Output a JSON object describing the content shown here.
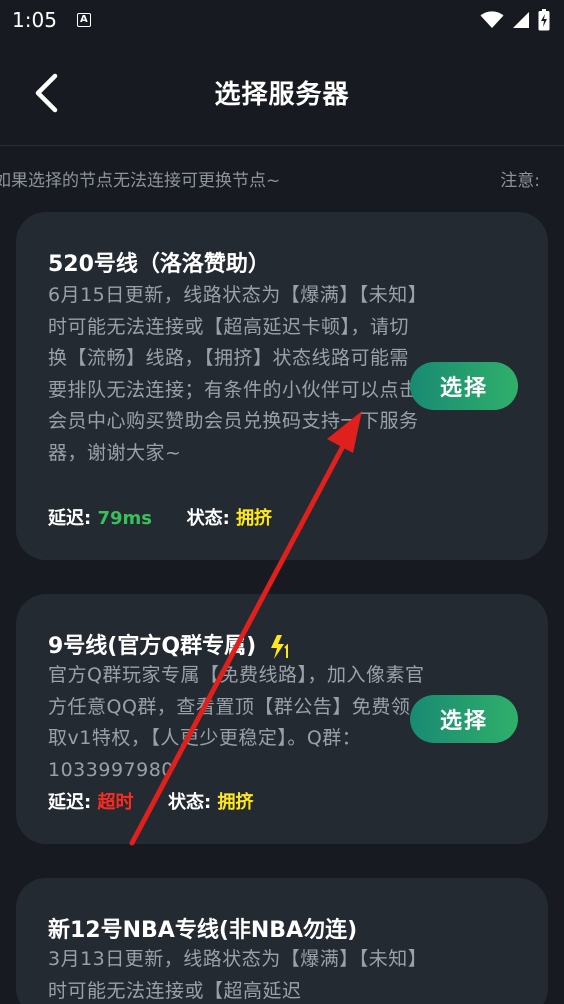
{
  "status_bar": {
    "time": "1:05",
    "a_badge": "A"
  },
  "header": {
    "title": "选择服务器"
  },
  "notice": {
    "text": "如果选择的节点无法连接可更换节点~",
    "label": "注意:"
  },
  "servers": [
    {
      "name": "520号线（洛洛赞助）",
      "description": "6月15日更新，线路状态为【爆满】【未知】时可能无法连接或【超高延迟卡顿】，请切换【流畅】线路，【拥挤】状态线路可能需要排队无法连接；有条件的小伙伴可以点击会员中心购买赞助会员兑换码支持一下服务器，谢谢大家~",
      "latency_label": "延迟:",
      "latency_value": "79ms",
      "status_label": "状态:",
      "status_value": "拥挤",
      "button_label": "选择"
    },
    {
      "name": "9号线(官方Q群专属)",
      "description": "官方Q群玩家专属【免费线路】，加入像素官方任意QQ群，查看置顶【群公告】免费领取v1特权，【人更少更稳定】。Q群：1033997980",
      "latency_label": "延迟:",
      "latency_value": "超时",
      "status_label": "状态:",
      "status_value": "拥挤",
      "button_label": "选择",
      "badge": "vip-bolt-icon"
    },
    {
      "name": "新12号NBA专线(非NBA勿连)",
      "description": "3月13日更新，线路状态为【爆满】【未知】时可能无法连接或【超高延迟"
    }
  ],
  "colors": {
    "background": "#171b21",
    "card": "#242a32",
    "latency_good": "#39c05a",
    "latency_bad": "#ff2a1f",
    "status_crowded": "#ffe81a",
    "button_gradient": [
      "#198a73",
      "#2fb06a"
    ],
    "annotation_arrow": "#e0201c"
  }
}
